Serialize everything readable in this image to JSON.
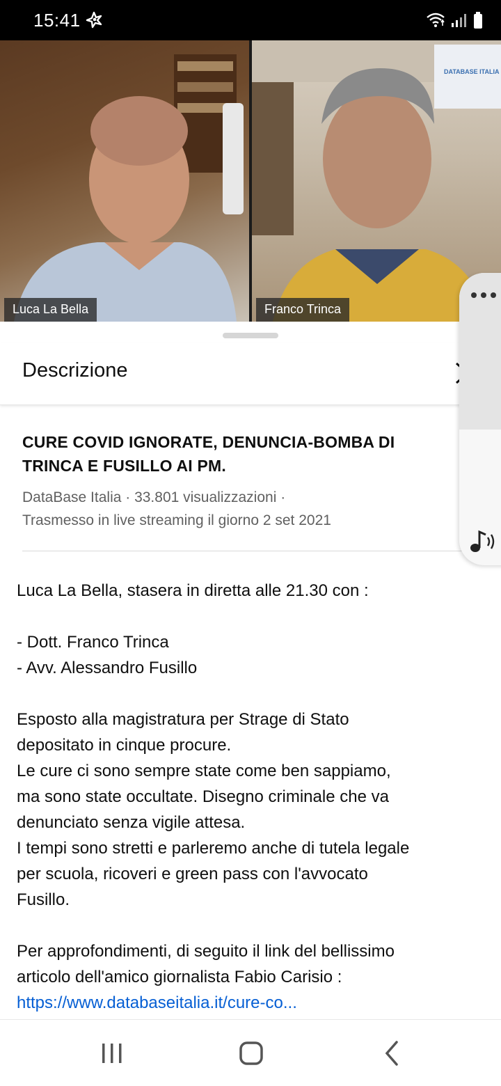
{
  "status_bar": {
    "time": "15:41"
  },
  "video": {
    "left_participant": "Luca La Bella",
    "right_participant": "Franco Trinca",
    "watermark": "DATABASE ITALIA"
  },
  "sheet": {
    "title": "Descrizione",
    "video_title": "CURE COVID IGNORATE, DENUNCIA-BOMBA DI TRINCA E FUSILLO AI PM.",
    "meta_line1": "DataBase Italia · 33.801 visualizzazioni ·",
    "meta_line2": "Trasmesso in live streaming il giorno 2 set 2021",
    "description": {
      "p1": "Luca La Bella, stasera in diretta alle 21.30 con :",
      "p2": "- Dott. Franco Trinca\n- Avv. Alessandro Fusillo",
      "p3": "Esposto alla magistratura per Strage di Stato\ndepositato in cinque procure.\nLe cure ci sono sempre state come ben sappiamo,\nma sono state occultate. Disegno criminale che va\ndenunciato senza vigile attesa.\nI tempi sono stretti e parleremo anche di tutela legale\nper scuola, ricoveri e green pass con l'avvocato\nFusillo.",
      "p4": "Per approfondimenti, di seguito il link del bellissimo\narticolo dell'amico giornalista Fabio Carisio :",
      "link": "https://www.databaseitalia.it/cure-co..."
    }
  },
  "side_panel": {
    "menu_icon": "more-dots-icon",
    "audio_icon": "music-note-icon"
  },
  "colors": {
    "link": "#065fd4",
    "meta": "#606060",
    "status_bar_bg": "#000000"
  }
}
